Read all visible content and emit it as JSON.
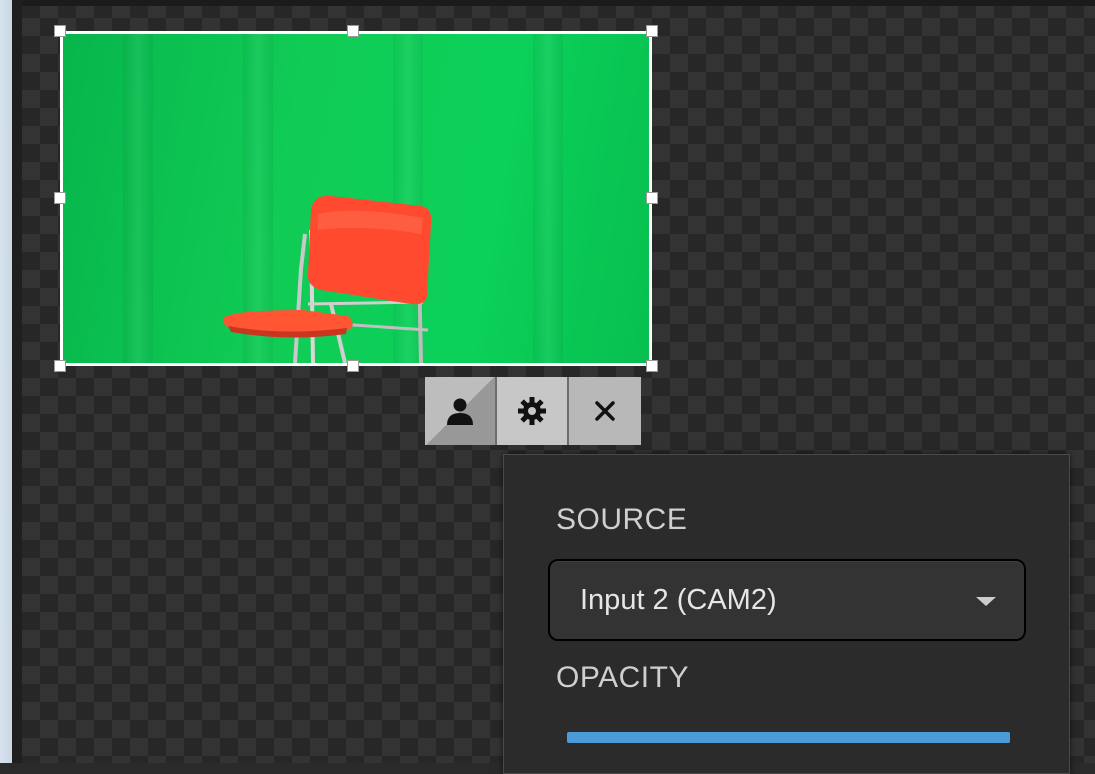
{
  "layer_toolbar": {
    "buttons": [
      {
        "icon": "person-icon",
        "glyph": "👤"
      },
      {
        "icon": "gear-icon",
        "glyph": "⚙"
      },
      {
        "icon": "close-icon",
        "glyph": "✕"
      }
    ]
  },
  "properties_panel": {
    "source_label": "SOURCE",
    "source_value": "Input 2 (CAM2)",
    "opacity_label": "OPACITY",
    "opacity_fraction": 1.0
  },
  "colors": {
    "greenscreen": "#0bd15a",
    "slider_accent": "#4a9bd6"
  }
}
